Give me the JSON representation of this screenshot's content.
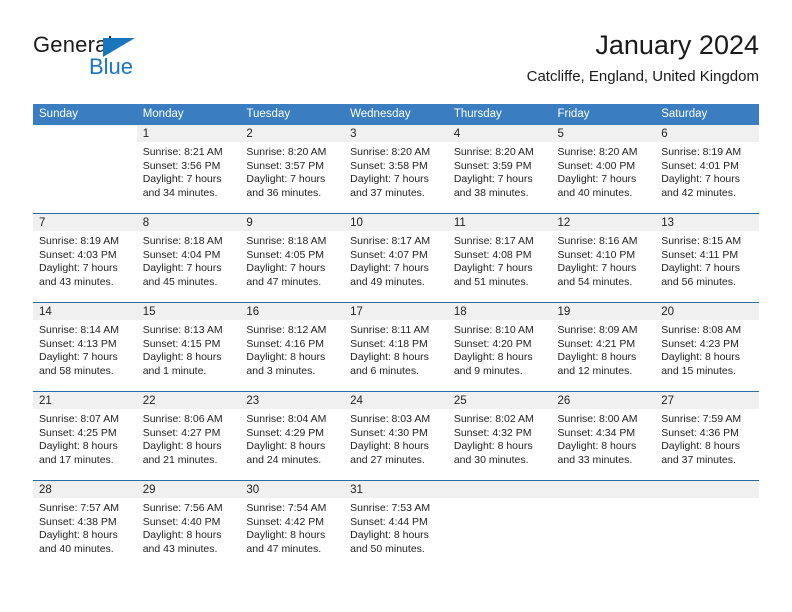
{
  "brand": {
    "name_part1": "General",
    "name_part2": "Blue",
    "flag_icon": "triangle-flag-icon"
  },
  "header": {
    "title": "January 2024",
    "subtitle": "Catcliffe, England, United Kingdom"
  },
  "colors": {
    "header_blue": "#3a7dc0",
    "row_divider_blue": "#2e6da4",
    "daynum_band": "#f0f0f0",
    "brand_blue": "#1b75bb"
  },
  "weekday_headers": [
    "Sunday",
    "Monday",
    "Tuesday",
    "Wednesday",
    "Thursday",
    "Friday",
    "Saturday"
  ],
  "weeks": [
    [
      {
        "day": "",
        "blank": true,
        "lines": []
      },
      {
        "day": "1",
        "lines": [
          "Sunrise: 8:21 AM",
          "Sunset: 3:56 PM",
          "Daylight: 7 hours",
          "and 34 minutes."
        ]
      },
      {
        "day": "2",
        "lines": [
          "Sunrise: 8:20 AM",
          "Sunset: 3:57 PM",
          "Daylight: 7 hours",
          "and 36 minutes."
        ]
      },
      {
        "day": "3",
        "lines": [
          "Sunrise: 8:20 AM",
          "Sunset: 3:58 PM",
          "Daylight: 7 hours",
          "and 37 minutes."
        ]
      },
      {
        "day": "4",
        "lines": [
          "Sunrise: 8:20 AM",
          "Sunset: 3:59 PM",
          "Daylight: 7 hours",
          "and 38 minutes."
        ]
      },
      {
        "day": "5",
        "lines": [
          "Sunrise: 8:20 AM",
          "Sunset: 4:00 PM",
          "Daylight: 7 hours",
          "and 40 minutes."
        ]
      },
      {
        "day": "6",
        "lines": [
          "Sunrise: 8:19 AM",
          "Sunset: 4:01 PM",
          "Daylight: 7 hours",
          "and 42 minutes."
        ]
      }
    ],
    [
      {
        "day": "7",
        "lines": [
          "Sunrise: 8:19 AM",
          "Sunset: 4:03 PM",
          "Daylight: 7 hours",
          "and 43 minutes."
        ]
      },
      {
        "day": "8",
        "lines": [
          "Sunrise: 8:18 AM",
          "Sunset: 4:04 PM",
          "Daylight: 7 hours",
          "and 45 minutes."
        ]
      },
      {
        "day": "9",
        "lines": [
          "Sunrise: 8:18 AM",
          "Sunset: 4:05 PM",
          "Daylight: 7 hours",
          "and 47 minutes."
        ]
      },
      {
        "day": "10",
        "lines": [
          "Sunrise: 8:17 AM",
          "Sunset: 4:07 PM",
          "Daylight: 7 hours",
          "and 49 minutes."
        ]
      },
      {
        "day": "11",
        "lines": [
          "Sunrise: 8:17 AM",
          "Sunset: 4:08 PM",
          "Daylight: 7 hours",
          "and 51 minutes."
        ]
      },
      {
        "day": "12",
        "lines": [
          "Sunrise: 8:16 AM",
          "Sunset: 4:10 PM",
          "Daylight: 7 hours",
          "and 54 minutes."
        ]
      },
      {
        "day": "13",
        "lines": [
          "Sunrise: 8:15 AM",
          "Sunset: 4:11 PM",
          "Daylight: 7 hours",
          "and 56 minutes."
        ]
      }
    ],
    [
      {
        "day": "14",
        "lines": [
          "Sunrise: 8:14 AM",
          "Sunset: 4:13 PM",
          "Daylight: 7 hours",
          "and 58 minutes."
        ]
      },
      {
        "day": "15",
        "lines": [
          "Sunrise: 8:13 AM",
          "Sunset: 4:15 PM",
          "Daylight: 8 hours",
          "and 1 minute."
        ]
      },
      {
        "day": "16",
        "lines": [
          "Sunrise: 8:12 AM",
          "Sunset: 4:16 PM",
          "Daylight: 8 hours",
          "and 3 minutes."
        ]
      },
      {
        "day": "17",
        "lines": [
          "Sunrise: 8:11 AM",
          "Sunset: 4:18 PM",
          "Daylight: 8 hours",
          "and 6 minutes."
        ]
      },
      {
        "day": "18",
        "lines": [
          "Sunrise: 8:10 AM",
          "Sunset: 4:20 PM",
          "Daylight: 8 hours",
          "and 9 minutes."
        ]
      },
      {
        "day": "19",
        "lines": [
          "Sunrise: 8:09 AM",
          "Sunset: 4:21 PM",
          "Daylight: 8 hours",
          "and 12 minutes."
        ]
      },
      {
        "day": "20",
        "lines": [
          "Sunrise: 8:08 AM",
          "Sunset: 4:23 PM",
          "Daylight: 8 hours",
          "and 15 minutes."
        ]
      }
    ],
    [
      {
        "day": "21",
        "lines": [
          "Sunrise: 8:07 AM",
          "Sunset: 4:25 PM",
          "Daylight: 8 hours",
          "and 17 minutes."
        ]
      },
      {
        "day": "22",
        "lines": [
          "Sunrise: 8:06 AM",
          "Sunset: 4:27 PM",
          "Daylight: 8 hours",
          "and 21 minutes."
        ]
      },
      {
        "day": "23",
        "lines": [
          "Sunrise: 8:04 AM",
          "Sunset: 4:29 PM",
          "Daylight: 8 hours",
          "and 24 minutes."
        ]
      },
      {
        "day": "24",
        "lines": [
          "Sunrise: 8:03 AM",
          "Sunset: 4:30 PM",
          "Daylight: 8 hours",
          "and 27 minutes."
        ]
      },
      {
        "day": "25",
        "lines": [
          "Sunrise: 8:02 AM",
          "Sunset: 4:32 PM",
          "Daylight: 8 hours",
          "and 30 minutes."
        ]
      },
      {
        "day": "26",
        "lines": [
          "Sunrise: 8:00 AM",
          "Sunset: 4:34 PM",
          "Daylight: 8 hours",
          "and 33 minutes."
        ]
      },
      {
        "day": "27",
        "lines": [
          "Sunrise: 7:59 AM",
          "Sunset: 4:36 PM",
          "Daylight: 8 hours",
          "and 37 minutes."
        ]
      }
    ],
    [
      {
        "day": "28",
        "lines": [
          "Sunrise: 7:57 AM",
          "Sunset: 4:38 PM",
          "Daylight: 8 hours",
          "and 40 minutes."
        ]
      },
      {
        "day": "29",
        "lines": [
          "Sunrise: 7:56 AM",
          "Sunset: 4:40 PM",
          "Daylight: 8 hours",
          "and 43 minutes."
        ]
      },
      {
        "day": "30",
        "lines": [
          "Sunrise: 7:54 AM",
          "Sunset: 4:42 PM",
          "Daylight: 8 hours",
          "and 47 minutes."
        ]
      },
      {
        "day": "31",
        "lines": [
          "Sunrise: 7:53 AM",
          "Sunset: 4:44 PM",
          "Daylight: 8 hours",
          "and 50 minutes."
        ]
      },
      {
        "day": "",
        "empty": true,
        "lines": []
      },
      {
        "day": "",
        "empty": true,
        "lines": []
      },
      {
        "day": "",
        "empty": true,
        "lines": []
      }
    ]
  ]
}
